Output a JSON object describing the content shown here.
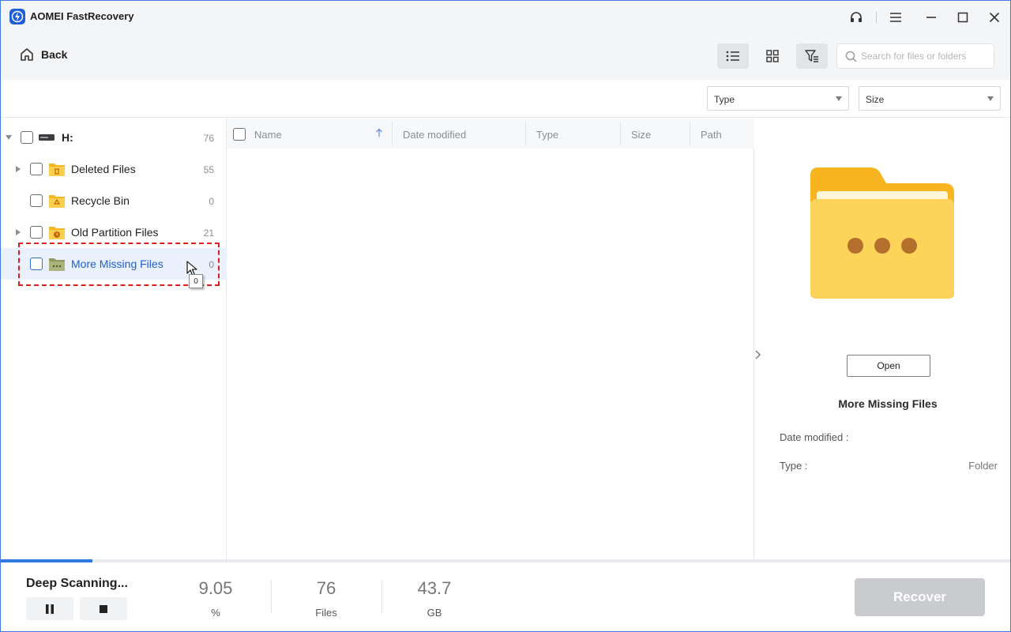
{
  "window": {
    "title": "AOMEI FastRecovery"
  },
  "toolbar": {
    "back_label": "Back",
    "search_placeholder": "Search for files or folders"
  },
  "filters": {
    "type_label": "Type",
    "size_label": "Size"
  },
  "tree": {
    "root": {
      "label": "H:",
      "count": "76"
    },
    "items": [
      {
        "label": "Deleted Files",
        "count": "55",
        "icon": "trash-folder-icon",
        "expandable": true
      },
      {
        "label": "Recycle Bin",
        "count": "0",
        "icon": "recycle-folder-icon",
        "expandable": false
      },
      {
        "label": "Old Partition Files",
        "count": "21",
        "icon": "clock-folder-icon",
        "expandable": true
      },
      {
        "label": "More Missing Files",
        "count": "0",
        "icon": "dots-folder-icon",
        "expandable": false,
        "selected": true
      }
    ],
    "tooltip": "0"
  },
  "file_list": {
    "columns": [
      "Name",
      "Date modified",
      "Type",
      "Size",
      "Path"
    ]
  },
  "preview": {
    "open_label": "Open",
    "name": "More Missing Files",
    "date_modified_label": "Date modified :",
    "date_modified_value": "",
    "type_label": "Type :",
    "type_value": "Folder"
  },
  "scan": {
    "status": "Deep Scanning...",
    "progress_percent": 9.05,
    "percent_value": "9.05",
    "percent_unit": "%",
    "files_value": "76",
    "files_unit": "Files",
    "size_value": "43.7",
    "size_unit": "GB"
  },
  "actions": {
    "recover_label": "Recover"
  },
  "colors": {
    "accent": "#1f5fd6",
    "highlight": "#d81f1f",
    "folder_yellow": "#fbc93a",
    "recover_disabled": "#c9cbcf"
  }
}
